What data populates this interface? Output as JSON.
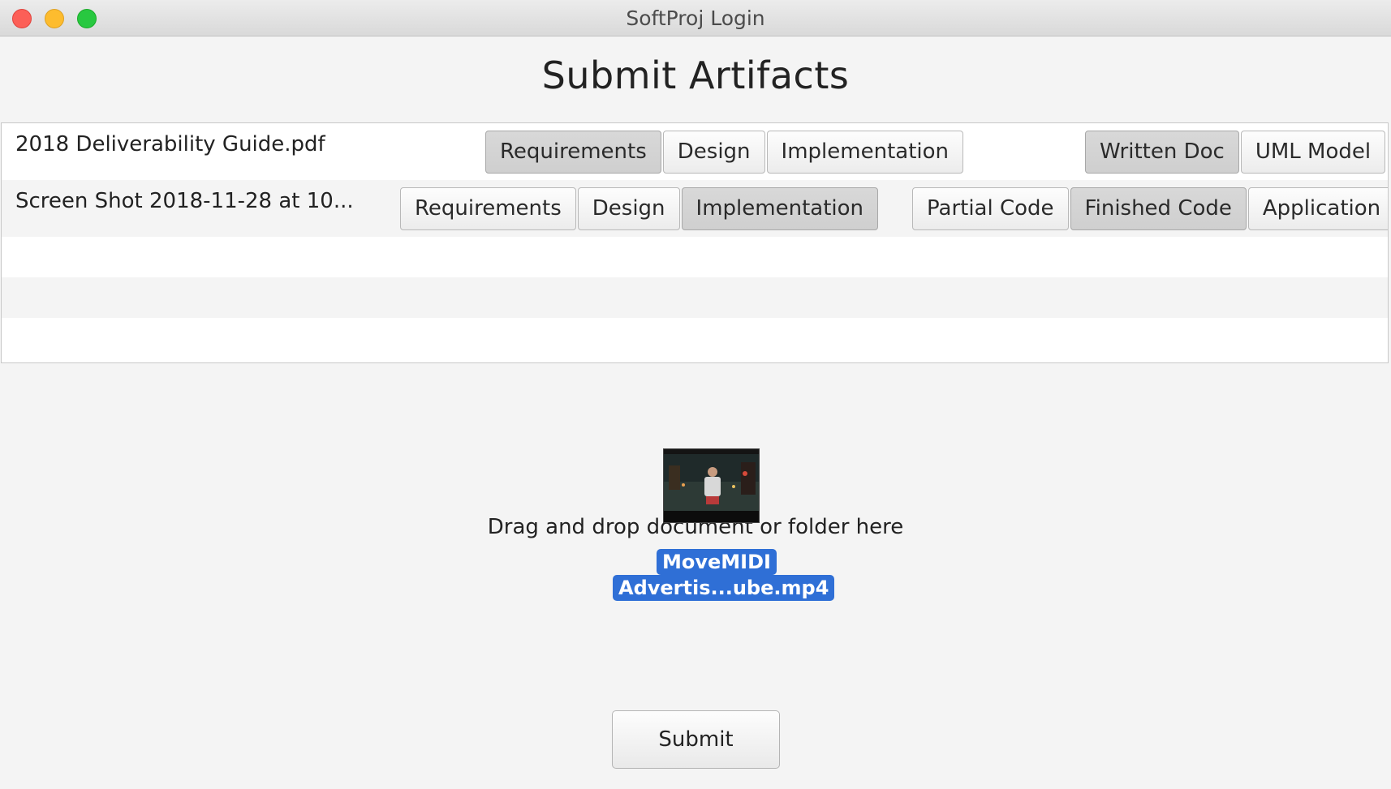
{
  "window": {
    "title": "SoftProj Login"
  },
  "page": {
    "title": "Submit Artifacts"
  },
  "artifacts": [
    {
      "file_name": "2018 Deliverability Guide.pdf",
      "phases": [
        {
          "label": "Requirements",
          "selected": true
        },
        {
          "label": "Design",
          "selected": false
        },
        {
          "label": "Implementation",
          "selected": false
        }
      ],
      "types": [
        {
          "label": "Written Doc",
          "selected": true
        },
        {
          "label": "UML Model",
          "selected": false
        }
      ]
    },
    {
      "file_name": "Screen Shot 2018-11-28 at 10...",
      "phases": [
        {
          "label": "Requirements",
          "selected": false
        },
        {
          "label": "Design",
          "selected": false
        },
        {
          "label": "Implementation",
          "selected": true
        }
      ],
      "types": [
        {
          "label": "Partial Code",
          "selected": false
        },
        {
          "label": "Finished Code",
          "selected": true
        },
        {
          "label": "Application",
          "selected": false
        }
      ]
    }
  ],
  "drop_zone": {
    "label": "Drag and drop document or folder here",
    "dragged_item_names": [
      "MoveMIDI",
      "Advertis...ube.mp4"
    ]
  },
  "actions": {
    "submit_label": "Submit"
  },
  "colors": {
    "close": "#fc5f57",
    "minimize": "#fdbc2e",
    "maximize": "#28c840",
    "drag_tag": "#2f6fd6"
  }
}
